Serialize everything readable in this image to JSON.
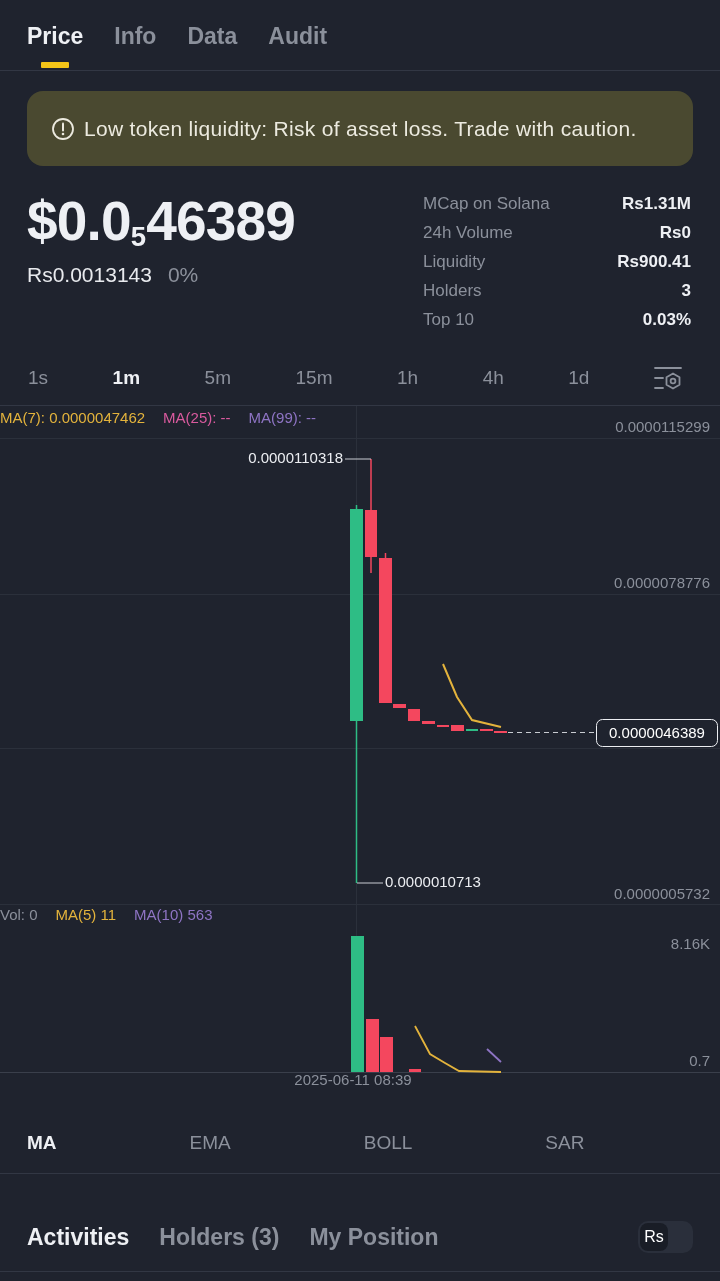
{
  "tabs": [
    {
      "label": "Price",
      "selected": true
    },
    {
      "label": "Info",
      "selected": false
    },
    {
      "label": "Data",
      "selected": false
    },
    {
      "label": "Audit",
      "selected": false
    }
  ],
  "warning": {
    "text": "Low token liquidity: Risk of asset loss. Trade with caution."
  },
  "price": {
    "value": "$0.0$_{5}$46389",
    "fiat": "Rs0.0013143",
    "change": "0%"
  },
  "stats": [
    {
      "label": "MCap on Solana",
      "value": "Rs1.31M"
    },
    {
      "label": "24h Volume",
      "value": "Rs0"
    },
    {
      "label": "Liquidity",
      "value": "Rs900.41"
    },
    {
      "label": "Holders",
      "value": "3"
    },
    {
      "label": "Top 10",
      "value": "0.03%"
    }
  ],
  "timeframes": [
    {
      "label": "1s",
      "selected": false
    },
    {
      "label": "1m",
      "selected": true
    },
    {
      "label": "5m",
      "selected": false
    },
    {
      "label": "15m",
      "selected": false
    },
    {
      "label": "1h",
      "selected": false
    },
    {
      "label": "4h",
      "selected": false
    },
    {
      "label": "1d",
      "selected": false
    }
  ],
  "price_chart": {
    "legend": [
      {
        "label": "MA(7): 0.0000047462",
        "color": "#e3b33c"
      },
      {
        "label": "MA(25): --",
        "color": "#d95a9e"
      },
      {
        "label": "MA(99): --",
        "color": "#8e74c4"
      }
    ],
    "axis_labels": [
      "0.0000115299",
      "0.0000078776",
      "0.0000005732"
    ],
    "high_label": "0.0000110318",
    "low_label": "0.0000010713",
    "last_price": "0.0000046389"
  },
  "volume_chart": {
    "legend": [
      {
        "label": "Vol: 0",
        "color": "#8b909b"
      },
      {
        "label": "MA(5) 11",
        "color": "#e3b33c"
      },
      {
        "label": "MA(10) 563",
        "color": "#8e74c4"
      }
    ],
    "axis_labels": [
      "8.16K",
      "0.7"
    ],
    "time_label": "2025-06-11 08:39"
  },
  "indicators": [
    {
      "label": "MA",
      "selected": true
    },
    {
      "label": "EMA",
      "selected": false
    },
    {
      "label": "BOLL",
      "selected": false
    },
    {
      "label": "SAR",
      "selected": false
    }
  ],
  "bottom_tabs": [
    {
      "label": "Activities",
      "selected": true
    },
    {
      "label": "Holders (3)",
      "selected": false
    },
    {
      "label": "My Position",
      "selected": false
    }
  ],
  "currency_toggle": {
    "label": "Rs",
    "on": false
  }
}
